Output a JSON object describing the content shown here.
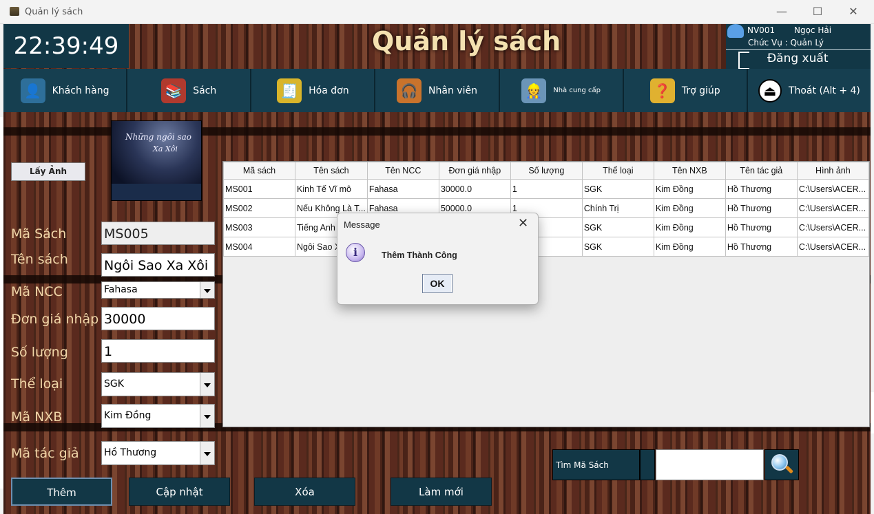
{
  "window": {
    "title": "Quản lý sách",
    "minimize": "—",
    "maximize": "☐",
    "close": "✕"
  },
  "header": {
    "clock": "22:39:49",
    "app_title": "Quản lý sách",
    "user_id": "NV001",
    "user_name": "Ngọc Hải",
    "role": "Chức Vụ : Quản Lý",
    "logout": "Đăng xuất"
  },
  "nav": [
    {
      "label": "Khách hàng",
      "icon": "customer-icon",
      "glyph": "👤"
    },
    {
      "label": "Sách",
      "icon": "books-icon",
      "glyph": "📚"
    },
    {
      "label": "Hóa đơn",
      "icon": "invoice-icon",
      "glyph": "🧾"
    },
    {
      "label": "Nhân viên",
      "icon": "employee-icon",
      "glyph": "🎧"
    },
    {
      "label": "Nhà cung cấp",
      "icon": "supplier-icon",
      "glyph": "👷"
    },
    {
      "label": "Trợ giúp",
      "icon": "help-icon",
      "glyph": "❓"
    },
    {
      "label": "Thoát (Alt + 4)",
      "icon": "exit-icon",
      "glyph": "⏏"
    }
  ],
  "form": {
    "get_image": "Lấy Ảnh",
    "cover_line1": "Những ngôi sao",
    "cover_line2": "Xa Xôi",
    "ma_sach_label": "Mã Sách",
    "ma_sach": "MS005",
    "ten_sach_label": "Tên sách",
    "ten_sach": "Ngôi Sao Xa Xôi",
    "ma_ncc_label": "Mã NCC",
    "ma_ncc": "Fahasa",
    "don_gia_label": "Đơn giá nhập",
    "don_gia": "30000",
    "so_luong_label": "Số lượng",
    "so_luong": "1",
    "the_loai_label": "Thể loại",
    "the_loai": "SGK",
    "ma_nxb_label": "Mã NXB",
    "ma_nxb": "Kim Đồng",
    "ma_tac_gia_label": "Mã tác giả",
    "ma_tac_gia": "Hồ Thương"
  },
  "table": {
    "columns": [
      "Mã sách",
      "Tên sách",
      "Tên NCC",
      "Đơn giá nhập",
      "Số lượng",
      "Thể loại",
      "Tên NXB",
      "Tên tác giả",
      "Hình ảnh"
    ],
    "rows": [
      [
        "MS001",
        "Kinh Tế Vĩ mô",
        "Fahasa",
        "30000.0",
        "1",
        "SGK",
        "Kim Đồng",
        "Hồ Thương",
        "C:\\Users\\ACER..."
      ],
      [
        "MS002",
        "Nếu Không Là T...",
        "Fahasa",
        "50000.0",
        "1",
        "Chính Trị",
        "Kim Đồng",
        "Hồ Thương",
        "C:\\Users\\ACER..."
      ],
      [
        "MS003",
        "Tiếng Anh",
        "",
        "",
        "",
        "SGK",
        "Kim Đồng",
        "Hồ Thương",
        "C:\\Users\\ACER..."
      ],
      [
        "MS004",
        "Ngôi Sao X",
        "",
        "",
        "",
        "SGK",
        "Kim Đồng",
        "Hồ Thương",
        "C:\\Users\\ACER..."
      ]
    ]
  },
  "search": {
    "combo_label": "Tìm Mã Sách",
    "value": ""
  },
  "actions": {
    "add": "Thêm",
    "update": "Cập nhật",
    "delete": "Xóa",
    "refresh": "Làm mới"
  },
  "dialog": {
    "title": "Message",
    "message": "Thêm Thành Công",
    "ok": "OK",
    "close": "✕"
  }
}
